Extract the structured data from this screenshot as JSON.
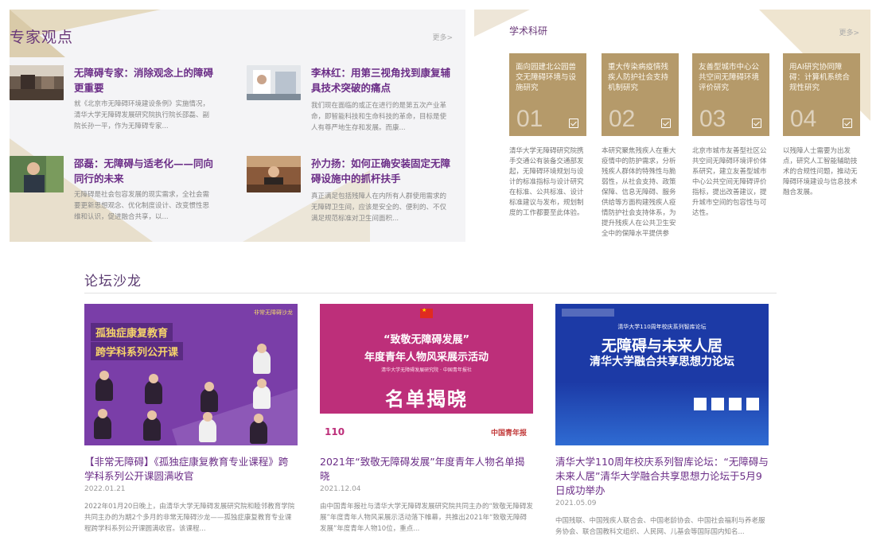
{
  "expert": {
    "title": "专家观点",
    "more": "更多>",
    "items": [
      {
        "title": "无障碍专家：消除观念上的障碍更重要",
        "desc": "就《北京市无障碍环境建设条例》实施情况，清华大学无障碍发展研究院执行院长邵磊、副院长孙一平，作为无障碍专家..."
      },
      {
        "title": "李林红：用第三视角找到康复辅具技术突破的痛点",
        "desc": "我们现在面临的或正在进行的是第五次产业革命，即智能科技和生命科技的革命，目标是使人有尊严地生存和发展。而康..."
      },
      {
        "title": "邵磊：无障碍与适老化——同向同行的未来",
        "desc": "无障碍是社会包容发展的现实需求，全社会需要更新思想观念、优化制度设计、改变惯性思维和认识，促进融合共享，以..."
      },
      {
        "title": "孙力扬：如何正确安装固定无障碍设施中的抓杆扶手",
        "desc": "真正满足包括残障人在内所有人群使用需求的无障碍卫生间，应该是安全的、便利的、不仅满足规范标准对卫生间面积..."
      }
    ]
  },
  "research": {
    "title": "学术科研",
    "more": "更多>",
    "cards": [
      {
        "num": "01",
        "title": "面向园建北公园兽交无障碍环境与设施研究",
        "desc": "清华大学无障碍研究院携手交通公有装备交通部发起，无障碍环境规划与设计的标准指标与设计研究在标准、公共标准、设计标准建议与发布，规划制度的工作都要至此体验。"
      },
      {
        "num": "02",
        "title": "重大传染病疫情残疾人防护社会支持机制研究",
        "desc": "本研究聚焦残疾人在重大疫情中的防护需求，分析残疾人群体的特殊性与脆弱性，从社会支持、政策保障、信息无障碍、服务供给等方面构建残疾人疫情防护社会支持体系，为提升残疾人在公共卫生安全中的保障水平提供参考。"
      },
      {
        "num": "03",
        "title": "友善型城市中心公共空间无障碍环境评价研究",
        "desc": "北京市城市友善型社区公共空间无障碍环境评价体系研究，建立友善型城市中心公共空间无障碍评价指标，提出改善建议，提升城市空间的包容性与可达性。"
      },
      {
        "num": "04",
        "title": "用AI研究协同障碍：计算机系统合规性研究",
        "desc": "以残障人士需要为出发点，研究人工智能辅助技术的合规性问题，推动无障碍环境建设与信息技术融合发展。"
      }
    ]
  },
  "forum": {
    "title": "论坛沙龙",
    "posts": [
      {
        "title": "【非常无障碍】《孤独症康复教育专业课程》跨学科系列公开课圆满收官",
        "date": "2022.01.21",
        "desc": "2022年01月20日晚上，由清华大学无障碍发展研究院和睦邻教育学院共同主办的为期2个多月的非常无障碍沙龙——孤独症康复教育专业课程跨学科系列公开课圆满收官。该课程...",
        "poster": {
          "line1": "孤独症康复教育",
          "line2": "跨学科系列公开课",
          "tag": "非常无障碍沙龙"
        }
      },
      {
        "title": "2021年“致敬无障碍发展”年度青年人物名单揭晓",
        "date": "2021.12.04",
        "desc": "由中国青年报社与清华大学无障碍发展研究院共同主办的“致敬无障碍发展”年度青年人物风采展示活动落下帷幕，共推出2021年“致敬无障碍发展”年度青年人物10位，重点...",
        "poster": {
          "line1": "“致敬无障碍发展”",
          "line2": "年度青年人物风采展示活动",
          "line3": "清华大学无障碍发展研究院 · 中国青年报社",
          "line4": "名单揭晓",
          "logo": "110",
          "seal": "中国青年报"
        }
      },
      {
        "title": "清华大学110周年校庆系列智库论坛：“无障碍与未来人居”清华大学融合共享思想力论坛于5月9日成功举办",
        "date": "2021.05.09",
        "desc": "中国残联、中国残疾人联合会、中国老龄协会、中国社会福利与养老服务协会、联合国教科文组织、人民网、儿基会等国际国内知名...",
        "poster": {
          "line1": "清华大学110周年校庆系列智库论坛",
          "line2": "无障碍与未来人居",
          "line3": "清华大学融合共享思想力论坛"
        }
      }
    ]
  },
  "colors": {
    "accent_purple": "#6b2d87",
    "gold": "#b59a6a"
  }
}
